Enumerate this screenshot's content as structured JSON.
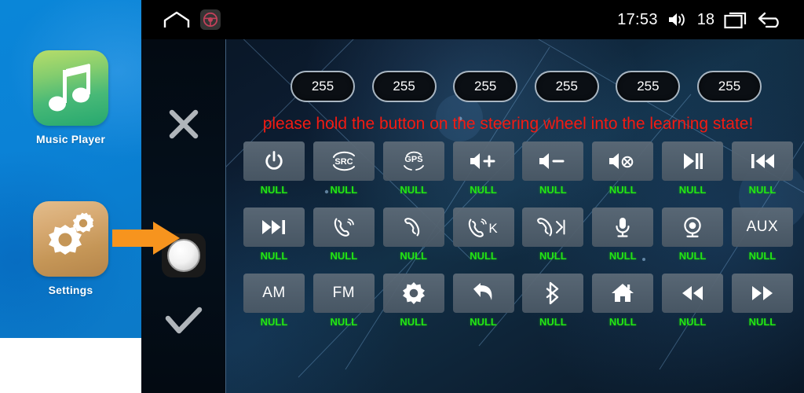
{
  "sidebar": {
    "apps": [
      {
        "label": "Music Player",
        "icon": "music-note-icon"
      },
      {
        "label": "Settings",
        "icon": "gears-icon"
      }
    ]
  },
  "pointer": {
    "icon": "orange-arrow-icon"
  },
  "statusbar": {
    "home_icon": "home-icon",
    "steering_wheel_icon": "steering-wheel-icon",
    "clock": "17:53",
    "volume_icon": "volume-icon",
    "volume_level": "18",
    "recents_icon": "recents-icon",
    "back_icon": "back-arrow-icon"
  },
  "controls": {
    "cancel_icon": "close-x-icon",
    "knob_icon": "knob-button-icon",
    "confirm_icon": "checkmark-icon"
  },
  "values": {
    "pills": [
      "255",
      "255",
      "255",
      "255",
      "255",
      "255"
    ]
  },
  "message": {
    "warning": "please hold the button on the steering wheel into the learning state!",
    "warning_color": "#f31b12"
  },
  "grid": {
    "null_label": "NULL",
    "null_color": "#23e614",
    "rows": [
      [
        {
          "icon": "power-icon",
          "text": "",
          "assigned": "NULL"
        },
        {
          "icon": "src-icon",
          "text": "",
          "assigned": "NULL"
        },
        {
          "icon": "gps-icon",
          "text": "",
          "assigned": "NULL"
        },
        {
          "icon": "volume-up-icon",
          "text": "",
          "assigned": "NULL"
        },
        {
          "icon": "volume-down-icon",
          "text": "",
          "assigned": "NULL"
        },
        {
          "icon": "mute-icon",
          "text": "",
          "assigned": "NULL"
        },
        {
          "icon": "play-pause-icon",
          "text": "",
          "assigned": "NULL"
        },
        {
          "icon": "previous-track-icon",
          "text": "",
          "assigned": "NULL"
        }
      ],
      [
        {
          "icon": "next-track-icon",
          "text": "",
          "assigned": "NULL"
        },
        {
          "icon": "answer-call-icon",
          "text": "",
          "assigned": "NULL"
        },
        {
          "icon": "hang-up-icon",
          "text": "",
          "assigned": "NULL"
        },
        {
          "icon": "call-key-icon",
          "text": "",
          "assigned": "NULL"
        },
        {
          "icon": "end-call-next-icon",
          "text": "",
          "assigned": "NULL"
        },
        {
          "icon": "microphone-icon",
          "text": "",
          "assigned": "NULL"
        },
        {
          "icon": "camera-icon",
          "text": "",
          "assigned": "NULL"
        },
        {
          "icon": "aux-text",
          "text": "AUX",
          "assigned": "NULL"
        }
      ],
      [
        {
          "icon": "am-text",
          "text": "AM",
          "assigned": "NULL"
        },
        {
          "icon": "fm-text",
          "text": "FM",
          "assigned": "NULL"
        },
        {
          "icon": "brightness-icon",
          "text": "",
          "assigned": "NULL"
        },
        {
          "icon": "return-arrow-icon",
          "text": "",
          "assigned": "NULL"
        },
        {
          "icon": "bluetooth-icon",
          "text": "",
          "assigned": "NULL"
        },
        {
          "icon": "home-fill-icon",
          "text": "",
          "assigned": "NULL"
        },
        {
          "icon": "rewind-icon",
          "text": "",
          "assigned": "NULL"
        },
        {
          "icon": "fast-forward-icon",
          "text": "",
          "assigned": "NULL"
        }
      ]
    ]
  }
}
